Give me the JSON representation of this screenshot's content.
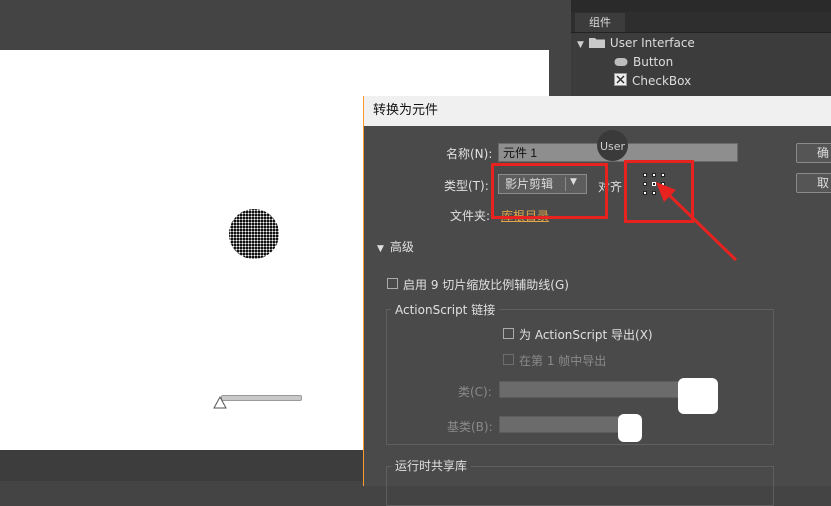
{
  "components_panel": {
    "tab_label": "组件",
    "folder_label": "User Interface",
    "items": [
      {
        "label": "Button",
        "icon": "button-icon"
      },
      {
        "label": "CheckBox",
        "icon": "checkbox-icon"
      }
    ]
  },
  "stage": {
    "background": "#ffffff",
    "shape": "halftone-circle"
  },
  "tooltip": {
    "text": "User"
  },
  "dialog": {
    "title": "转换为元件",
    "name_label": "名称(N):",
    "name_value": "元件 1",
    "type_label": "类型(T):",
    "type_value": "影片剪辑",
    "align_label": "对齐",
    "folder_label": "文件夹:",
    "folder_link": "库根目录",
    "ok_label": "确",
    "cancel_label": "取",
    "advanced_label": "高级",
    "nine_slice_label": "启用 9 切片缩放比例辅助线(G)",
    "as_group_title": "ActionScript 链接",
    "export_as_label": "为 ActionScript 导出(X)",
    "export_frame1_label": "在第 1 帧中导出",
    "class_label": "类(C):",
    "class_value": "",
    "base_label": "基类(B):",
    "base_value": "",
    "runtime_group_title": "运行时共享库"
  },
  "annotation": {
    "highlight_color": "#e8231f"
  }
}
